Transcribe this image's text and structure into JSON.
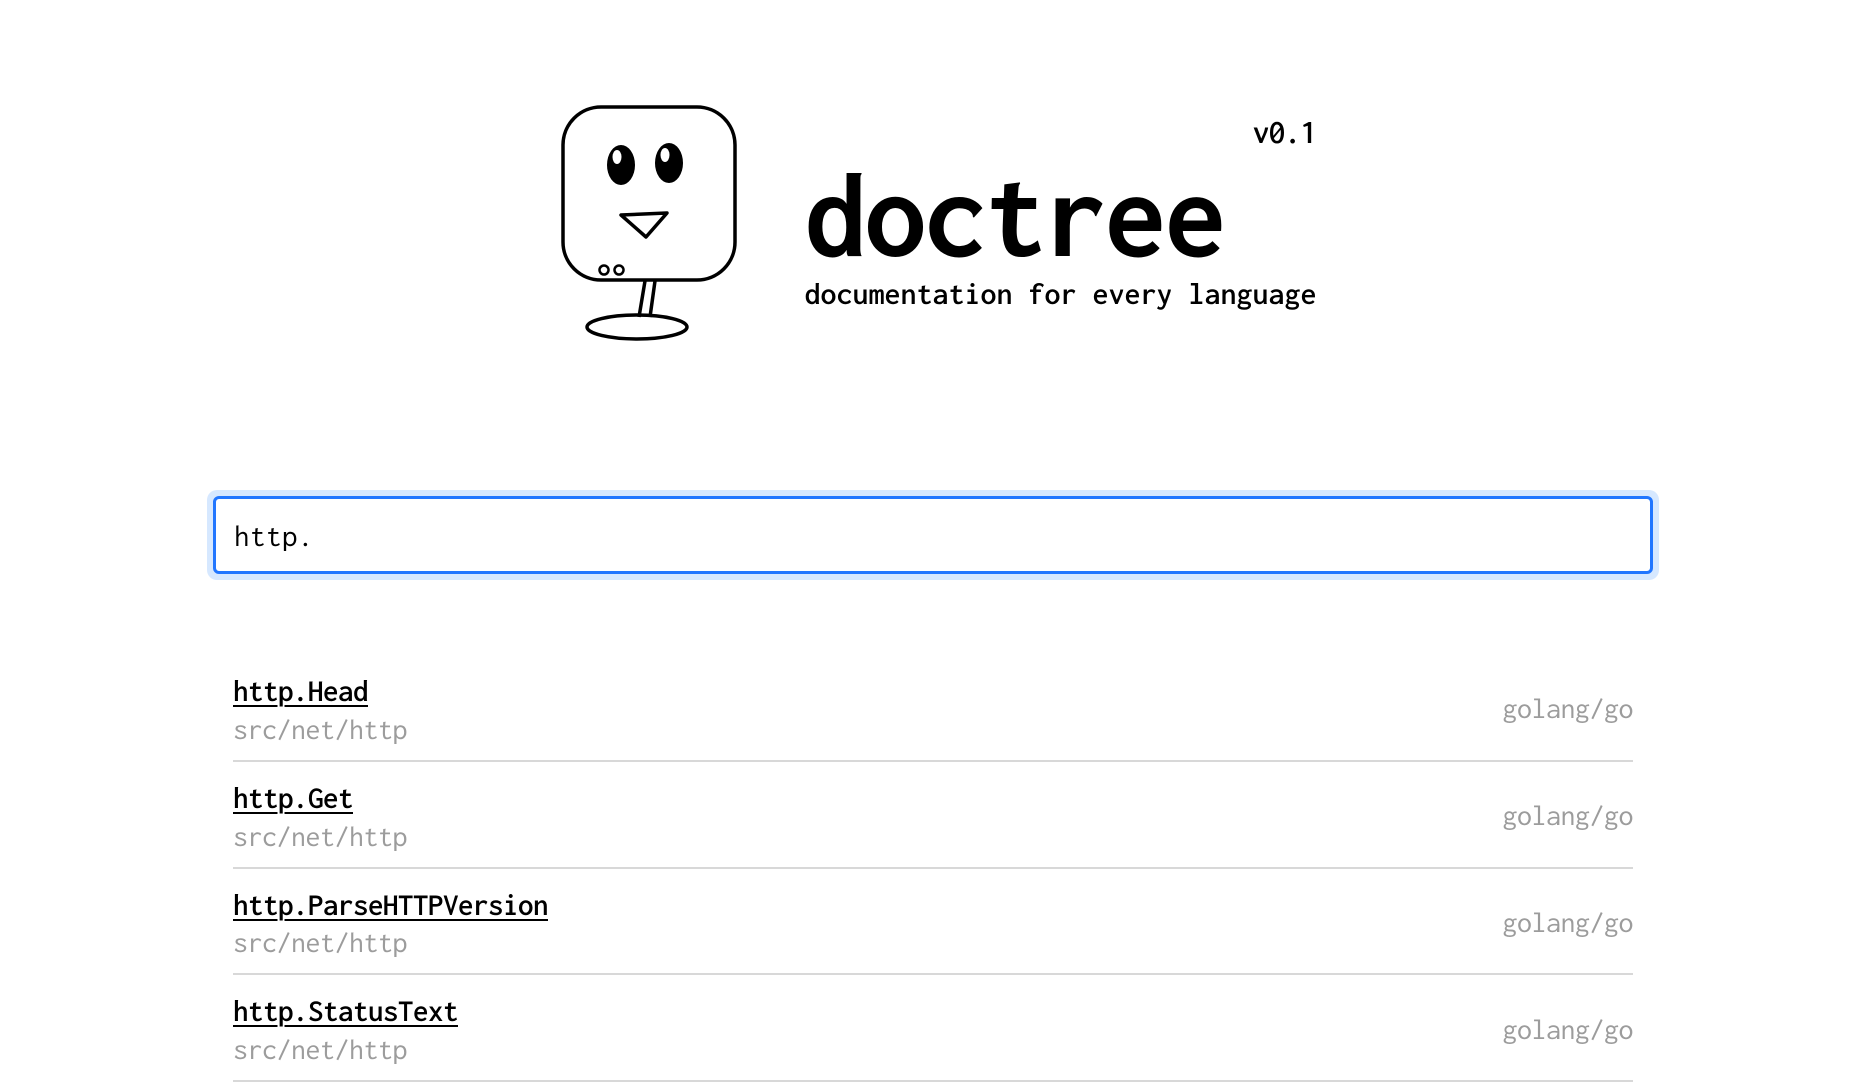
{
  "header": {
    "title": "doctree",
    "subtitle": "documentation for every language",
    "version": "v0.1"
  },
  "search": {
    "value": "http.",
    "placeholder": ""
  },
  "results": [
    {
      "name": "http.Head",
      "path": "src/net/http",
      "repo": "golang/go"
    },
    {
      "name": "http.Get",
      "path": "src/net/http",
      "repo": "golang/go"
    },
    {
      "name": "http.ParseHTTPVersion",
      "path": "src/net/http",
      "repo": "golang/go"
    },
    {
      "name": "http.StatusText",
      "path": "src/net/http",
      "repo": "golang/go"
    }
  ]
}
